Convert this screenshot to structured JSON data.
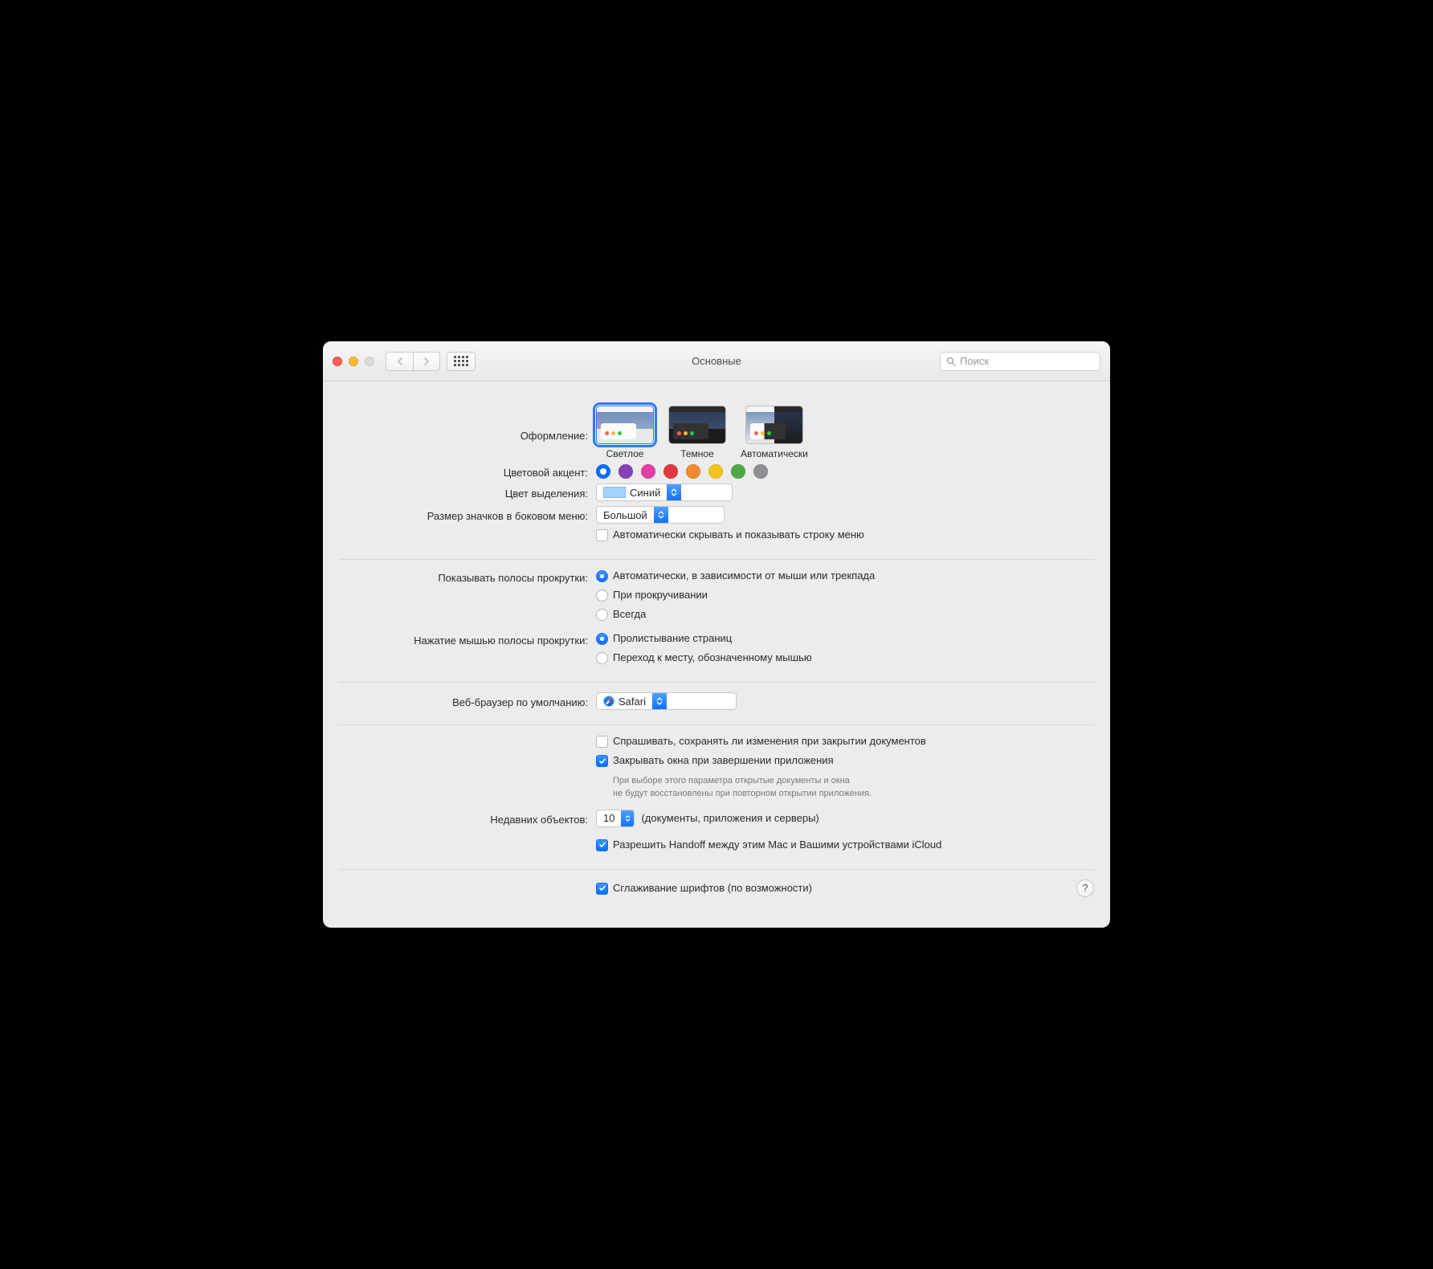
{
  "window": {
    "title": "Основные"
  },
  "search": {
    "placeholder": "Поиск"
  },
  "appearance": {
    "label": "Оформление:",
    "options": [
      "Светлое",
      "Темное",
      "Автоматически"
    ],
    "selected": 0
  },
  "accent": {
    "label": "Цветовой акцент:",
    "colors": [
      "#0a6fff",
      "#8640b8",
      "#e23fa5",
      "#e0383e",
      "#f08a2c",
      "#f5c31e",
      "#4fa845",
      "#8e8e93"
    ],
    "selected": 0
  },
  "highlight": {
    "label": "Цвет выделения:",
    "value": "Синий"
  },
  "sidebar_icon": {
    "label": "Размер значков в боковом меню:",
    "value": "Большой"
  },
  "menubar_autohide": {
    "checked": false,
    "label": "Автоматически скрывать и показывать строку меню"
  },
  "scrollbars": {
    "label": "Показывать полосы прокрутки:",
    "options": [
      "Автоматически, в зависимости от мыши или трекпада",
      "При прокручивании",
      "Всегда"
    ],
    "selected": 0
  },
  "scroll_click": {
    "label": "Нажатие мышью полосы прокрутки:",
    "options": [
      "Пролистывание страниц",
      "Переход к месту, обозначенному мышью"
    ],
    "selected": 0
  },
  "browser": {
    "label": "Веб-браузер по умолчанию:",
    "value": "Safari"
  },
  "ask_save": {
    "checked": false,
    "label": "Спрашивать, сохранять ли изменения при закрытии документов"
  },
  "close_windows": {
    "checked": true,
    "label": "Закрывать окна при завершении приложения",
    "hint1": "При выборе этого параметра открытые документы и окна",
    "hint2": "не будут восстановлены при повторном открытии приложения."
  },
  "recent": {
    "label": "Недавних объектов:",
    "value": "10",
    "suffix": "(документы, приложения и серверы)"
  },
  "handoff": {
    "checked": true,
    "label": "Разрешить Handoff между этим Mac и Вашими устройствами iCloud"
  },
  "font_smoothing": {
    "checked": true,
    "label": "Сглаживание шрифтов (по возможности)"
  },
  "help": "?"
}
